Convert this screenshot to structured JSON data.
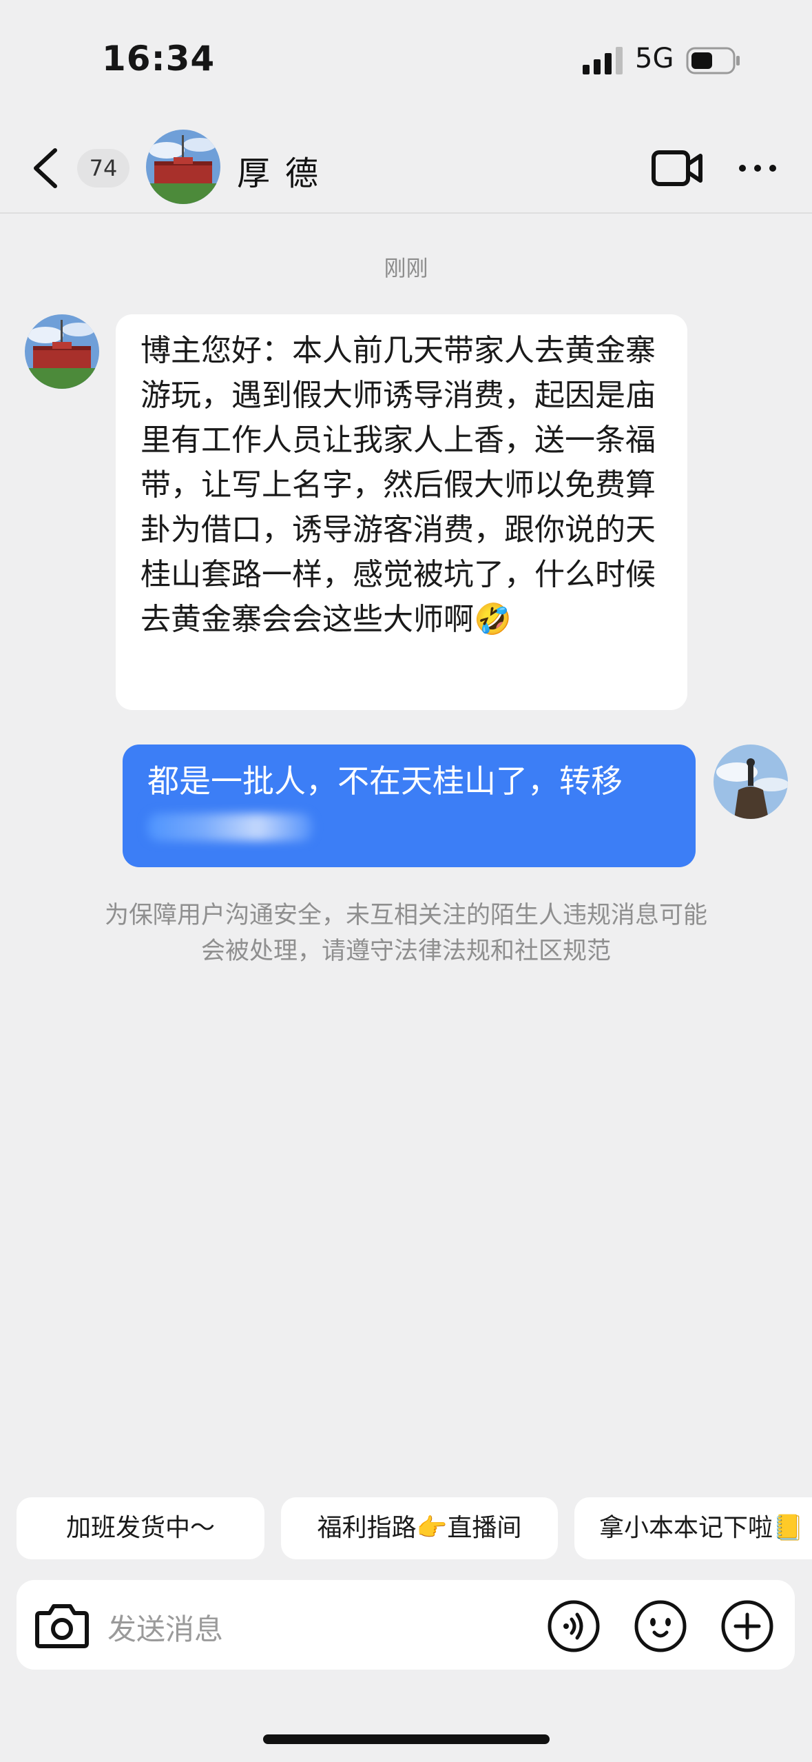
{
  "status_bar": {
    "time": "16:34",
    "network": "5G"
  },
  "header": {
    "unread_count": "74",
    "contact_name": "厚德"
  },
  "chat": {
    "timestamp": "刚刚",
    "received_message": "博主您好：本人前几天带家人去黄金寨游玩，遇到假大师诱导消费，起因是庙里有工作人员让我家人上香，送一条福带，让写上名字，然后假大师以免费算卦为借口，诱导游客消费，跟你说的天桂山套路一样，感觉被坑了，什么时候去黄金寨会会这些大师啊🤣",
    "sent_message": "都是一批人，不在天桂山了，转移",
    "safety_notice": "为保障用户沟通安全，未互相关注的陌生人违规消息可能会被处理，请遵守法律法规和社区规范"
  },
  "quick_replies": [
    "加班发货中～",
    "福利指路👉直播间",
    "拿小本本记下啦📒"
  ],
  "input": {
    "placeholder": "发送消息"
  },
  "colors": {
    "sent_bubble": "#3c7ef6",
    "background": "#efeff0"
  }
}
